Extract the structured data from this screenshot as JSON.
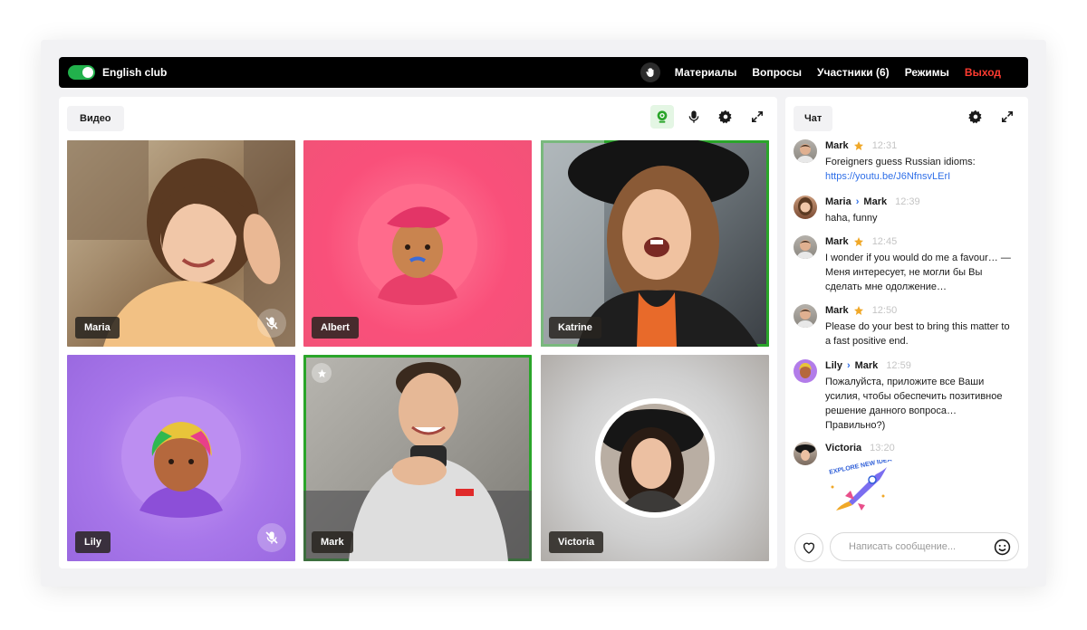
{
  "topbar": {
    "club_name": "English club",
    "nav": {
      "materials": "Материалы",
      "questions": "Вопросы",
      "participants": "Участники (6)",
      "modes": "Режимы",
      "exit": "Выход"
    },
    "colors": {
      "toggle_on": "#22b14c",
      "exit": "#ff3b30",
      "background": "#000000"
    }
  },
  "video": {
    "tab_label": "Видео",
    "toolbar_icons": [
      "camera-icon",
      "microphone-icon",
      "gear-icon",
      "expand-icon"
    ],
    "tiles": [
      {
        "name": "Maria",
        "muted": true,
        "speaking": false,
        "type": "photo"
      },
      {
        "name": "Albert",
        "muted": false,
        "speaking": false,
        "type": "avatar"
      },
      {
        "name": "Katrine",
        "muted": false,
        "speaking": true,
        "type": "photo"
      },
      {
        "name": "Lily",
        "muted": true,
        "speaking": false,
        "type": "avatar"
      },
      {
        "name": "Mark",
        "muted": false,
        "speaking": true,
        "type": "photo",
        "host": true
      },
      {
        "name": "Victoria",
        "muted": false,
        "speaking": false,
        "type": "avatar-photo"
      }
    ],
    "colors": {
      "speaking_border": "#2aa52a"
    }
  },
  "chat": {
    "tab_label": "Чат",
    "messages": [
      {
        "author": "Mark",
        "starred": true,
        "time": "12:31",
        "text": "Foreigners guess Russian idioms:",
        "link": "https://youtu.be/J6NfnsvLErI"
      },
      {
        "author": "Maria",
        "to": "Mark",
        "time": "12:39",
        "text": "haha, funny"
      },
      {
        "author": "Mark",
        "starred": true,
        "time": "12:45",
        "text": "I wonder if you would do me a favour… — Меня интересует, не могли бы Вы сделать мне одолжение…"
      },
      {
        "author": "Mark",
        "starred": true,
        "time": "12:50",
        "text": "Please do your best to bring this matter to a fast positive end."
      },
      {
        "author": "Lily",
        "to": "Mark",
        "time": "12:59",
        "text": "Пожалуйста, приложите все Ваши усилия, чтобы обеспечить позитивное решение данного вопроса… Правильно?)"
      },
      {
        "author": "Victoria",
        "time": "13:20",
        "sticker": "EXPLORE NEW IDEAS"
      }
    ],
    "input_placeholder": "Написать сообщение...",
    "colors": {
      "link": "#2f6fe8",
      "star": "#f0a828",
      "time": "#c4c4c4"
    }
  }
}
